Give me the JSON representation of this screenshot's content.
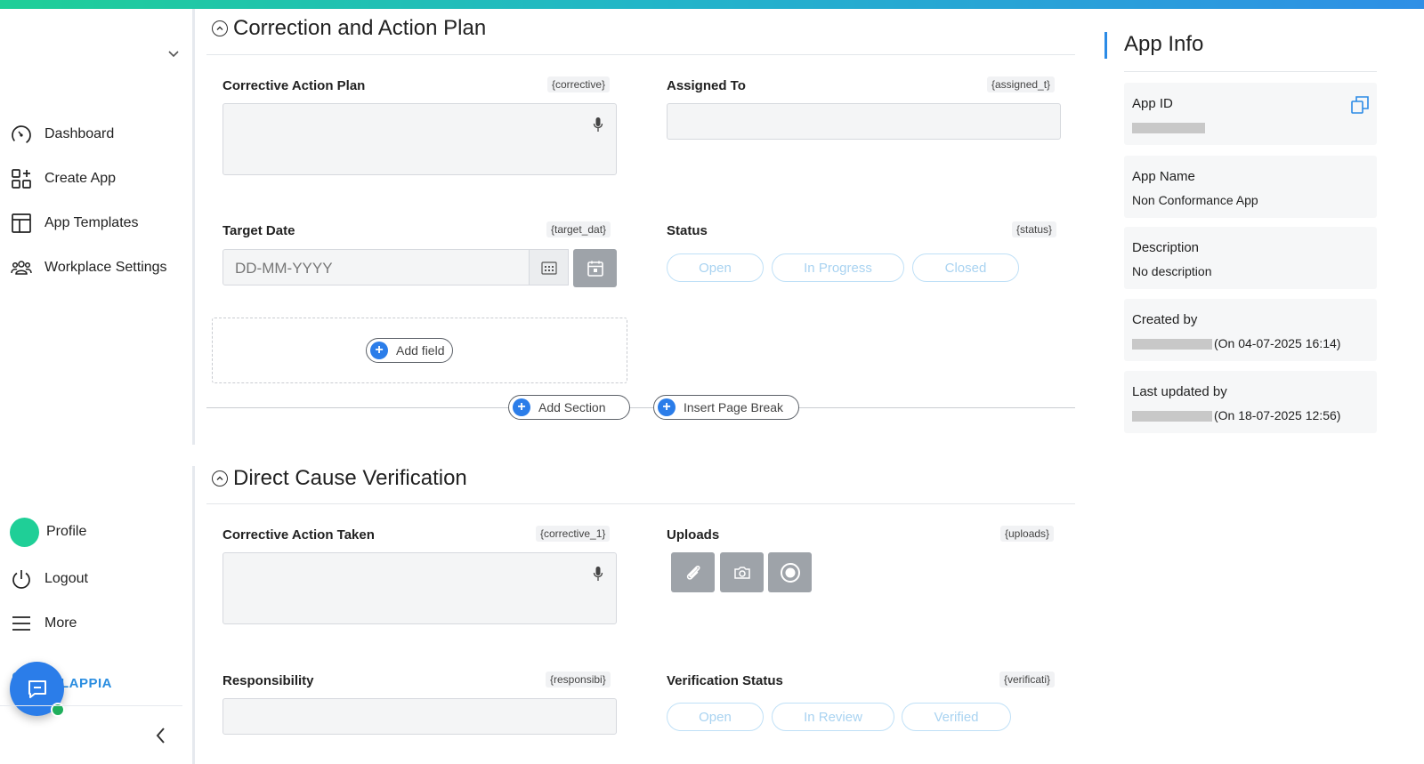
{
  "sidebar": {
    "items": [
      {
        "label": "Dashboard",
        "icon": "dashboard-gauge-icon"
      },
      {
        "label": "Create App",
        "icon": "create-app-grid-icon"
      },
      {
        "label": "App Templates",
        "icon": "templates-layout-icon"
      },
      {
        "label": "Workplace Settings",
        "icon": "people-group-icon"
      }
    ],
    "bottom": [
      {
        "label": "Profile",
        "icon": "avatar"
      },
      {
        "label": "Logout",
        "icon": "power-icon"
      },
      {
        "label": "More",
        "icon": "hamburger-icon"
      }
    ],
    "brand": "LAPPIA"
  },
  "sections": [
    {
      "title": "Correction and Action Plan",
      "fields": {
        "corrective_action_plan": {
          "label": "Corrective Action Plan",
          "var": "{corrective}"
        },
        "assigned_to": {
          "label": "Assigned To",
          "var": "{assigned_t}"
        },
        "target_date": {
          "label": "Target Date",
          "var": "{target_dat}",
          "placeholder": "DD-MM-YYYY"
        },
        "status": {
          "label": "Status",
          "var": "{status}",
          "options": [
            "Open",
            "In Progress",
            "Closed"
          ]
        }
      },
      "add_field": "Add field"
    },
    {
      "title": "Direct Cause Verification",
      "fields": {
        "corrective_action_taken": {
          "label": "Corrective Action Taken",
          "var": "{corrective_1}"
        },
        "uploads": {
          "label": "Uploads",
          "var": "{uploads}"
        },
        "responsibility": {
          "label": "Responsibility",
          "var": "{responsibi}"
        },
        "verification_status": {
          "label": "Verification Status",
          "var": "{verificati}",
          "options": [
            "Open",
            "In Review",
            "Verified"
          ]
        }
      }
    }
  ],
  "actions": {
    "add_section": "Add Section",
    "insert_page_break": "Insert Page Break"
  },
  "app_info": {
    "title": "App Info",
    "app_id_label": "App ID",
    "app_name_label": "App Name",
    "app_name": "Non Conformance App",
    "description_label": "Description",
    "description": "No description",
    "created_by_label": "Created by",
    "created_on": "(On 04-07-2025 16:14)",
    "updated_by_label": "Last updated by",
    "updated_on": "(On 18-07-2025 12:56)"
  },
  "colors": {
    "accent": "#2b7de9",
    "brand_green": "#1fcf97",
    "pill_border": "#bfe0f7"
  }
}
